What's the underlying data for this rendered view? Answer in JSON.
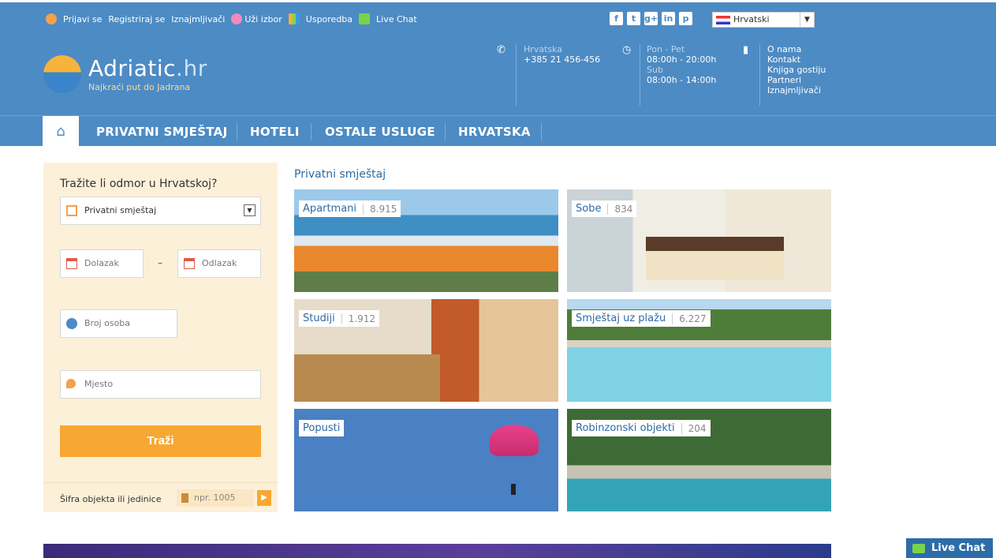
{
  "topbar": {
    "login": "Prijavi se",
    "register": "Registriraj se",
    "landlords": "Iznajmljivači",
    "shortlist": "Uži izbor",
    "compare": "Usporedba",
    "livechat": "Live Chat",
    "social": [
      "f",
      "t",
      "g+",
      "in",
      "p"
    ],
    "language": "Hrvatski"
  },
  "header": {
    "logo_main": "Adriatic",
    "logo_suffix": ".hr",
    "tagline": "Najkraći put do Jadrana",
    "phone_label": "Hrvatska",
    "phone": "+385 21 456-456",
    "hours_week_label": "Pon - Pet",
    "hours_week": "08:00h - 20:00h",
    "hours_sat_label": "Sub",
    "hours_sat": "08:00h - 14:00h",
    "links": [
      "O nama",
      "Kontakt",
      "Knjiga gostiju",
      "Partneri",
      "Iznajmljivači"
    ]
  },
  "nav": {
    "items": [
      "PRIVATNI SMJEŠTAJ",
      "HOTELI",
      "OSTALE USLUGE",
      "HRVATSKA"
    ]
  },
  "search": {
    "title": "Tražite li odmor u Hrvatskoj?",
    "type": "Privatni smještaj",
    "arrival": "Dolazak",
    "departure": "Odlazak",
    "dash": "–",
    "persons": "Broj osoba",
    "place": "Mjesto",
    "submit": "Traži",
    "code_label": "Šifra objekta ili jedinice",
    "code_placeholder": "npr. 1005"
  },
  "listing": {
    "title": "Privatni smještaj",
    "tiles": [
      {
        "label": "Apartmani",
        "count": "8.915"
      },
      {
        "label": "Sobe",
        "count": "834"
      },
      {
        "label": "Studiji",
        "count": "1.912"
      },
      {
        "label": "Smještaj uz plažu",
        "count": "6.227"
      },
      {
        "label": "Popusti",
        "count": ""
      },
      {
        "label": "Robinzonski objekti",
        "count": "204"
      }
    ]
  },
  "livechat_button": "Live Chat",
  "colors": {
    "brand": "#4d8bc4",
    "accent": "#f7a833",
    "panel": "#fdf0d9"
  }
}
